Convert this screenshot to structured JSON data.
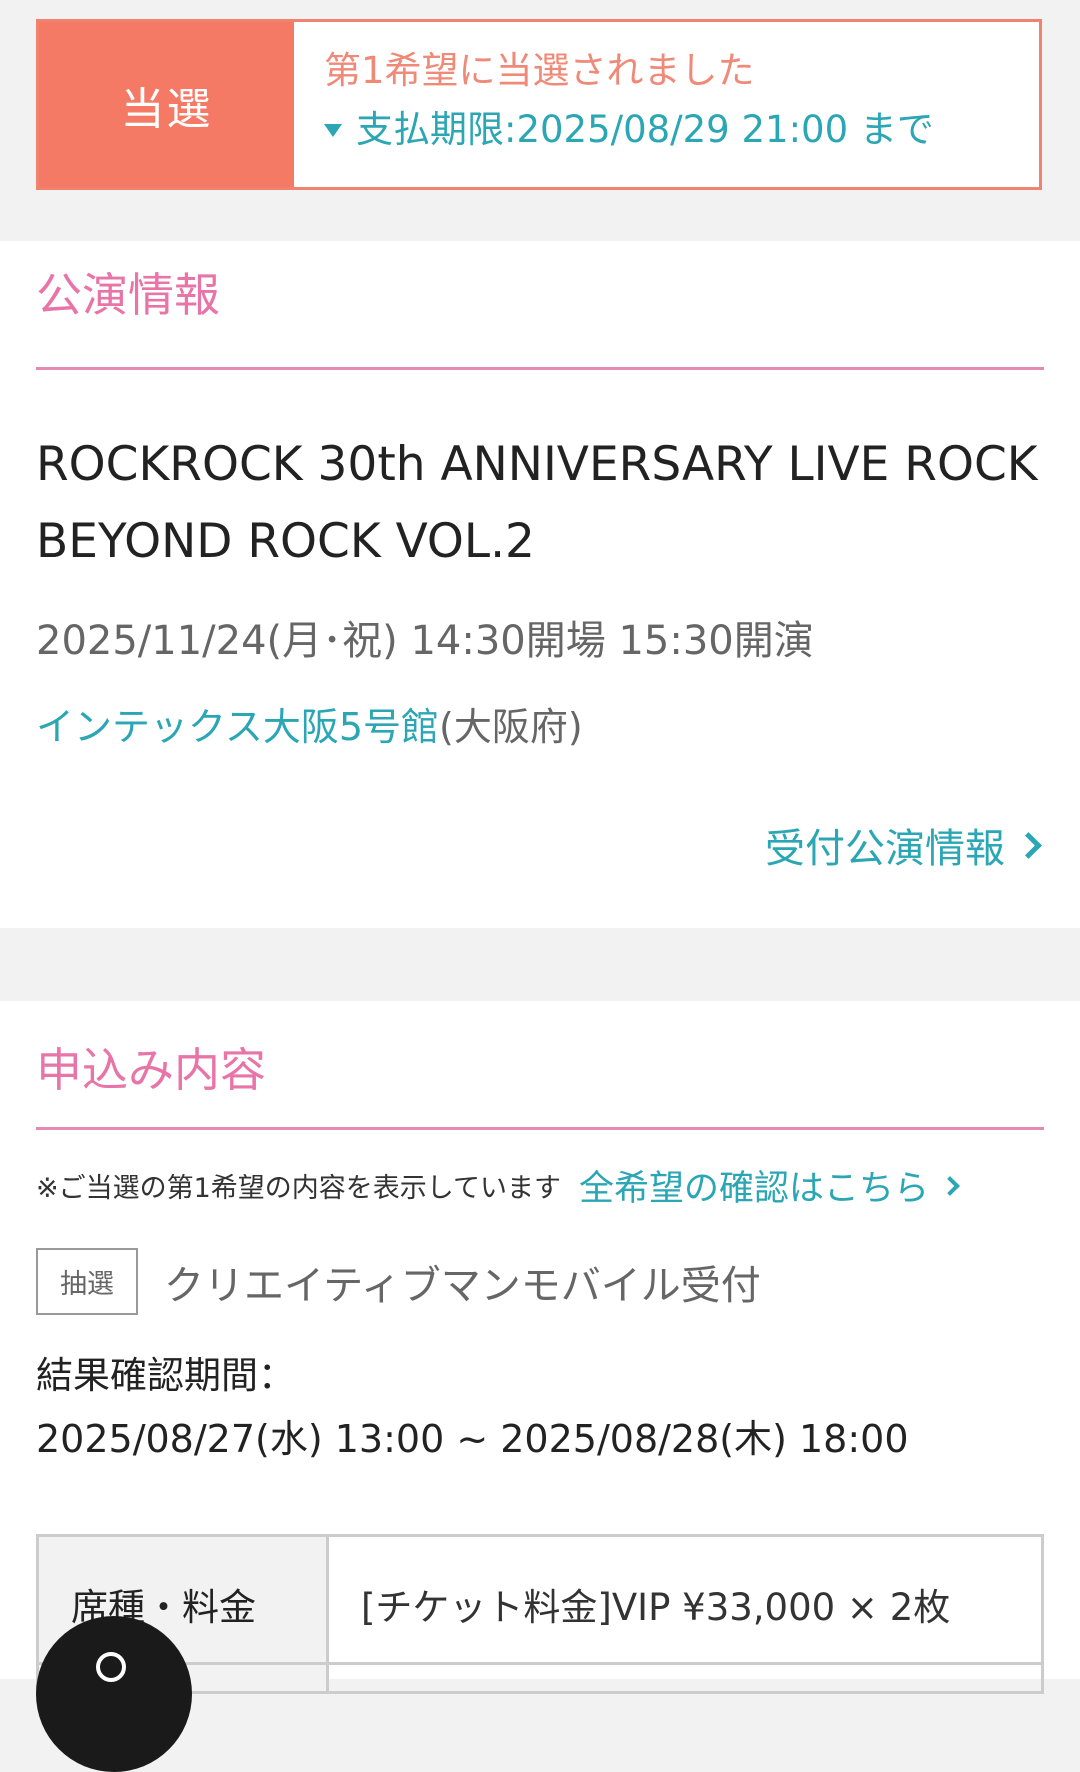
{
  "status": {
    "badge": "当選",
    "title": "第1希望に当選されました",
    "deadline": "支払期限:2025/08/29 21:00 まで"
  },
  "event_section": {
    "heading": "公演情報",
    "title": "ROCKROCK 30th ANNIVERSARY LIVE ROCK BEYOND ROCK VOL.2",
    "datetime": "2025/11/24(月･祝) 14:30開場 15:30開演",
    "venue": "インテックス大阪5号館",
    "prefecture": "(大阪府)",
    "more_link": "受付公演情報"
  },
  "application_section": {
    "heading": "申込み内容",
    "note": "※ご当選の第1希望の内容を表示しています",
    "all_wishes_link": "全希望の確認はこちら",
    "lottery_badge": "抽選",
    "reception_name": "クリエイティブマンモバイル受付",
    "period_label": "結果確認期間：",
    "period_value": "2025/08/27(水) 13:00 ~ 2025/08/28(木) 18:00",
    "table": {
      "header": "席種・料金",
      "value": "[チケット料金]VIP ¥33,000 × 2枚"
    }
  },
  "colors": {
    "accent_pink": "#e874a8",
    "link_teal": "#2aa6b4",
    "won_coral": "#f47a66"
  }
}
